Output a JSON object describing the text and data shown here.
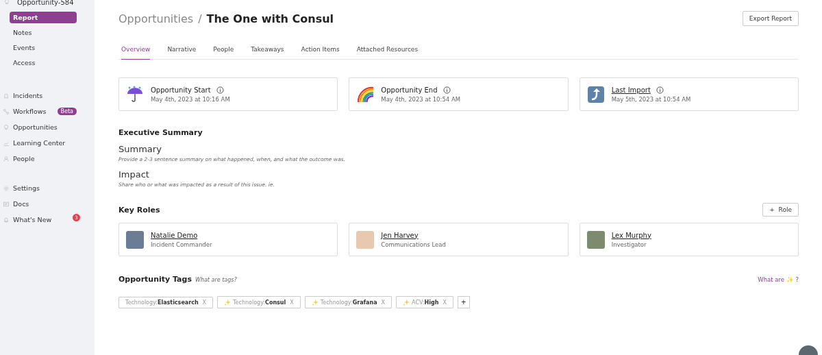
{
  "sidebar": {
    "context": "Opportunity-584",
    "sub_items": [
      {
        "label": "Report",
        "selected": true
      },
      {
        "label": "Notes",
        "selected": false
      },
      {
        "label": "Events",
        "selected": false
      },
      {
        "label": "Access",
        "selected": false
      }
    ],
    "groups": [
      [
        {
          "label": "Incidents",
          "kind": "incident"
        },
        {
          "label": "Workflows",
          "kind": "workflow",
          "badge": "Beta"
        },
        {
          "label": "Opportunities",
          "kind": "bulb"
        },
        {
          "label": "Learning Center",
          "kind": "chart"
        },
        {
          "label": "People",
          "kind": "person"
        }
      ],
      [
        {
          "label": "Settings",
          "kind": "gear"
        },
        {
          "label": "Docs",
          "kind": "doc"
        },
        {
          "label": "What's New",
          "kind": "bell",
          "count": "3"
        }
      ]
    ]
  },
  "header": {
    "parent": "Opportunities",
    "separator": "/",
    "title": "The One with Consul",
    "export_button": "Export Report"
  },
  "tabs": [
    {
      "label": "Overview",
      "selected": true
    },
    {
      "label": "Narrative",
      "selected": false
    },
    {
      "label": "People",
      "selected": false
    },
    {
      "label": "Takeaways",
      "selected": false
    },
    {
      "label": "Action Items",
      "selected": false
    },
    {
      "label": "Attached Resources",
      "selected": false
    }
  ],
  "time_cards": [
    {
      "kind": "umbrella",
      "title": "Opportunity Start",
      "link": false,
      "time": "May 4th, 2023 at 10:16 AM"
    },
    {
      "kind": "rainbow",
      "title": "Opportunity End",
      "link": false,
      "time": "May 4th, 2023 at 10:54 AM"
    },
    {
      "kind": "import",
      "title": "Last Import",
      "link": true,
      "time": "May 5th, 2023 at 10:54 AM"
    }
  ],
  "executive_summary": {
    "heading": "Executive Summary",
    "sections": [
      {
        "title": "Summary",
        "hint": "Provide a 2-3 sentence summary on what happened, when, and what the outcome was."
      },
      {
        "title": "Impact",
        "hint": "Share who or what was impacted as a result of this issue. ie."
      }
    ]
  },
  "key_roles": {
    "heading": "Key Roles",
    "add_button": "+  Role",
    "roles": [
      {
        "name": "Natalie Demo",
        "role": "Incident Commander"
      },
      {
        "name": "Jen Harvey",
        "role": "Communications Lead"
      },
      {
        "name": "Lex Murphy",
        "role": "Investigator"
      }
    ]
  },
  "tags": {
    "heading": "Opportunity Tags",
    "help": "What are tags?",
    "link": "What are ✨ ?",
    "add": "+",
    "items": [
      {
        "key": "Technology:",
        "value": "Elasticsearch",
        "sparkle": false,
        "remove": "X"
      },
      {
        "key": "Technology:",
        "value": "Consul",
        "sparkle": true,
        "remove": "X"
      },
      {
        "key": "Technology:",
        "value": "Grafana",
        "sparkle": true,
        "remove": "X"
      },
      {
        "key": "ACV:",
        "value": "High",
        "sparkle": true,
        "remove": "X"
      }
    ]
  }
}
